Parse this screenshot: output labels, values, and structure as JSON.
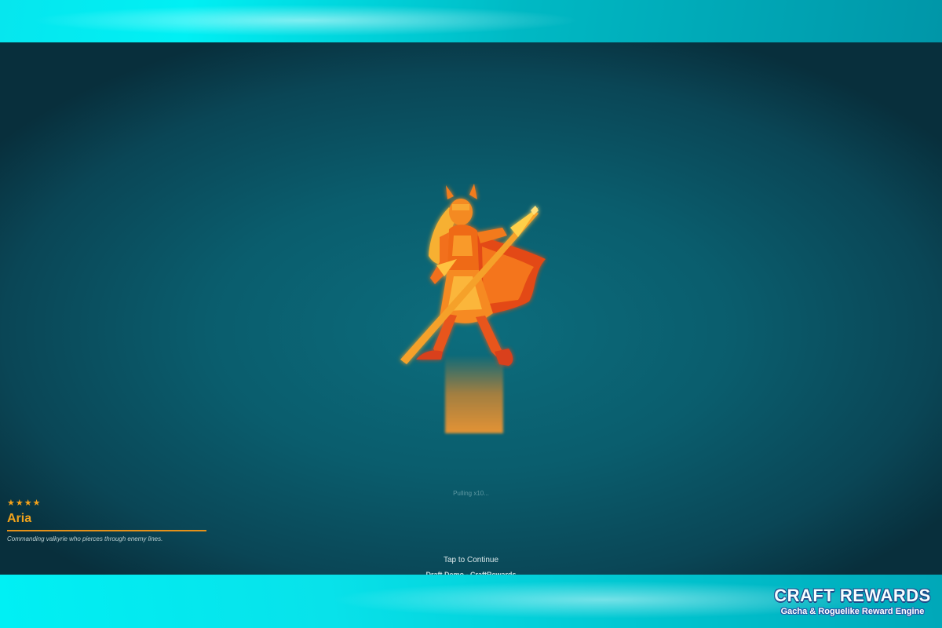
{
  "reward": {
    "rarity_stars": "★★★★",
    "name": "Aria",
    "description": "Commanding valkyrie who pierces through enemy lines.",
    "sprite_icon": "valkyrie-sprite",
    "accent_color": "#f0a31c"
  },
  "status": {
    "pulling": "Pulling x10..."
  },
  "prompt": {
    "tap_to_continue": "Tap to Continue"
  },
  "footer": {
    "credit": "Draft Demo - CraftRewards"
  },
  "logo": {
    "title": "CRAFT REWARDS",
    "subtitle": "Gacha & Roguelike Reward Engine"
  },
  "colors": {
    "frame": "#00e8f0",
    "stage": "#0a5d6d",
    "glow": "#e88a2a"
  }
}
